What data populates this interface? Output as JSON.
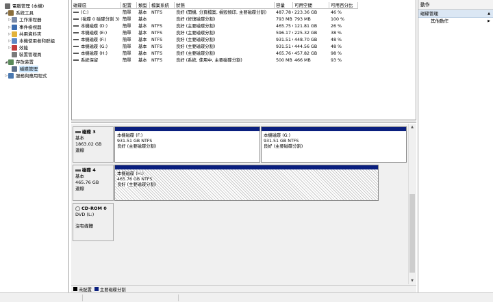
{
  "tree": {
    "items": [
      {
        "label": "電腦管理 (本機)",
        "icon": "computer-management-icon",
        "color": "#6a6a6a",
        "expander": "",
        "indent": 0,
        "selected": false
      },
      {
        "label": "系統工具",
        "icon": "system-tools-icon",
        "color": "#8a6d3b",
        "expander": "◢",
        "indent": 1,
        "selected": false
      },
      {
        "label": "工作排程器",
        "icon": "clock-icon",
        "color": "#7a8aa8",
        "expander": "▷",
        "indent": 2,
        "selected": false
      },
      {
        "label": "事件檢視器",
        "icon": "event-viewer-icon",
        "color": "#3d6db0",
        "expander": "▷",
        "indent": 2,
        "selected": false
      },
      {
        "label": "共用資料夾",
        "icon": "shared-folder-icon",
        "color": "#e2b23a",
        "expander": "▷",
        "indent": 2,
        "selected": false
      },
      {
        "label": "本機使用者和群組",
        "icon": "users-icon",
        "color": "#5b87c5",
        "expander": "▷",
        "indent": 2,
        "selected": false
      },
      {
        "label": "效能",
        "icon": "performance-icon",
        "color": "#c23b3b",
        "expander": "▷",
        "indent": 2,
        "selected": false
      },
      {
        "label": "裝置管理員",
        "icon": "device-manager-icon",
        "color": "#7a7a7a",
        "expander": "",
        "indent": 2,
        "selected": false
      },
      {
        "label": "存放裝置",
        "icon": "storage-icon",
        "color": "#5a8a5a",
        "expander": "◢",
        "indent": 1,
        "selected": false
      },
      {
        "label": "磁碟管理",
        "icon": "disk-management-icon",
        "color": "#5d6f8a",
        "expander": "",
        "indent": 2,
        "selected": true
      },
      {
        "label": "服務與應用程式",
        "icon": "services-icon",
        "color": "#4a78b0",
        "expander": "▷",
        "indent": 1,
        "selected": false
      }
    ]
  },
  "volume_list": {
    "headers": [
      "磁碟區",
      "配置",
      "類型",
      "檔案系統",
      "狀態",
      "容量",
      "可用空間",
      "可用百分比"
    ],
    "rows": [
      [
        "(C:)",
        "簡單",
        "基本",
        "NTFS",
        "良好 (開機, 分頁檔案, 損毀傾印, 主要磁碟分割)",
        "487.78 GB",
        "223.36 GB",
        "46 %"
      ],
      [
        "(磁碟 0 磁碟分割 3)",
        "簡單",
        "基本",
        "",
        "良好 (修復磁碟分割)",
        "793 MB",
        "793 MB",
        "100 %"
      ],
      [
        "本機磁碟 (D:)",
        "簡單",
        "基本",
        "NTFS",
        "良好 (主要磁碟分割)",
        "465.75 GB",
        "121.81 GB",
        "26 %"
      ],
      [
        "本機磁碟 (E:)",
        "簡單",
        "基本",
        "NTFS",
        "良好 (主要磁碟分割)",
        "596.17 GB",
        "225.32 GB",
        "38 %"
      ],
      [
        "本機磁碟 (F:)",
        "簡單",
        "基本",
        "NTFS",
        "良好 (主要磁碟分割)",
        "931.51 GB",
        "448.70 GB",
        "48 %"
      ],
      [
        "本機磁碟 (G:)",
        "簡單",
        "基本",
        "NTFS",
        "良好 (主要磁碟分割)",
        "931.51 GB",
        "444.56 GB",
        "48 %"
      ],
      [
        "本機磁碟 (H:)",
        "簡單",
        "基本",
        "NTFS",
        "良好 (主要磁碟分割)",
        "465.76 GB",
        "457.82 GB",
        "98 %"
      ],
      [
        "系統保留",
        "簡單",
        "基本",
        "NTFS",
        "良好 (系統, 使用中, 主要磁碟分割)",
        "500 MB",
        "466 MB",
        "93 %"
      ]
    ]
  },
  "disks": [
    {
      "name": "磁碟 3",
      "type": "基本",
      "size": "1863.02 GB",
      "status": "連線",
      "partitions": [
        {
          "name": "本機磁碟  (F:)",
          "size": "931.51 GB NTFS",
          "status": "良好 (主要磁碟分割)",
          "hatched": false
        },
        {
          "name": "本機磁碟  (G:)",
          "size": "931.51 GB NTFS",
          "status": "良好 (主要磁碟分割)",
          "hatched": false
        }
      ]
    },
    {
      "name": "磁碟 4",
      "type": "基本",
      "size": "465.76 GB",
      "status": "連線",
      "partitions": [
        {
          "name": "本機磁碟  (H:)",
          "size": "465.76 GB NTFS",
          "status": "良好 (主要磁碟分割)",
          "hatched": true
        }
      ]
    }
  ],
  "cdrom": {
    "name": "CD-ROM 0",
    "drive": "DVD (L:)",
    "media": "沒有媒體"
  },
  "legend": {
    "unallocated": "未配置",
    "primary": "主要磁碟分割"
  },
  "colors": {
    "primary_bar": "#0a1f7e",
    "unallocated": "#000000",
    "selection": "#cde8ff",
    "action_section": "#dbe7f4"
  },
  "actions": {
    "title": "動作",
    "section": "磁碟管理",
    "more": "其他動作"
  }
}
